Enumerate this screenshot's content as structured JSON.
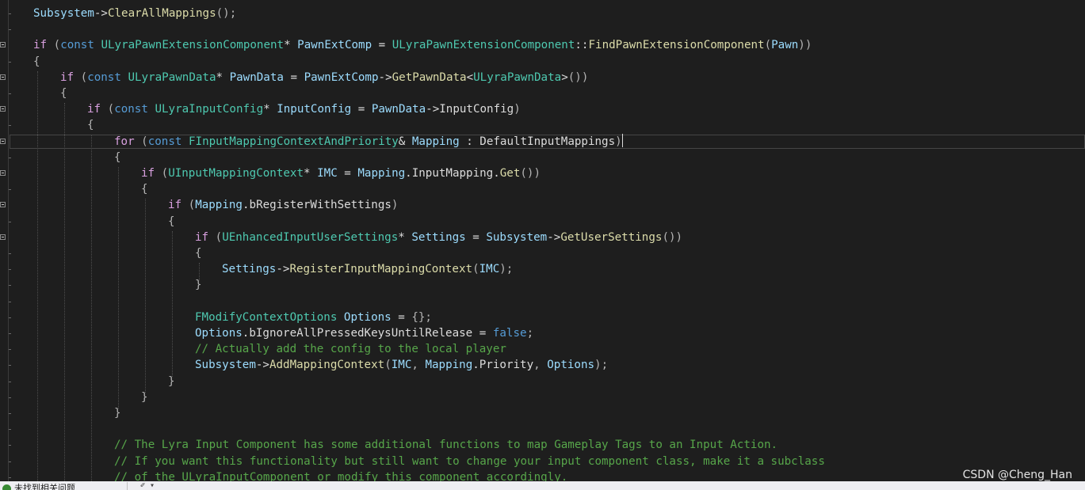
{
  "lines": [
    {
      "indent": 1,
      "tokens": [
        [
          "var",
          "Subsystem"
        ],
        [
          "op",
          "->"
        ],
        [
          "fn",
          "ClearAllMappings"
        ],
        [
          "pn",
          "();"
        ]
      ]
    },
    {
      "indent": 0,
      "tokens": []
    },
    {
      "indent": 1,
      "tokens": [
        [
          "ctl",
          "if"
        ],
        [
          "pn",
          " ("
        ],
        [
          "kw",
          "const"
        ],
        [
          "tx",
          " "
        ],
        [
          "typ",
          "ULyraPawnExtensionComponent"
        ],
        [
          "op",
          "*"
        ],
        [
          "tx",
          " "
        ],
        [
          "var",
          "PawnExtComp"
        ],
        [
          "op",
          " = "
        ],
        [
          "typ",
          "ULyraPawnExtensionComponent"
        ],
        [
          "op",
          "::"
        ],
        [
          "fn",
          "FindPawnExtensionComponent"
        ],
        [
          "pn",
          "("
        ],
        [
          "var",
          "Pawn"
        ],
        [
          "pn",
          "))"
        ]
      ]
    },
    {
      "indent": 1,
      "tokens": [
        [
          "pn",
          "{"
        ]
      ]
    },
    {
      "indent": 2,
      "tokens": [
        [
          "ctl",
          "if"
        ],
        [
          "pn",
          " ("
        ],
        [
          "kw",
          "const"
        ],
        [
          "tx",
          " "
        ],
        [
          "typ",
          "ULyraPawnData"
        ],
        [
          "op",
          "*"
        ],
        [
          "tx",
          " "
        ],
        [
          "var",
          "PawnData"
        ],
        [
          "op",
          " = "
        ],
        [
          "var",
          "PawnExtComp"
        ],
        [
          "op",
          "->"
        ],
        [
          "fn",
          "GetPawnData"
        ],
        [
          "op",
          "<"
        ],
        [
          "typ",
          "ULyraPawnData"
        ],
        [
          "op",
          ">"
        ],
        [
          "pn",
          "())"
        ]
      ]
    },
    {
      "indent": 2,
      "tokens": [
        [
          "pn",
          "{"
        ]
      ]
    },
    {
      "indent": 3,
      "tokens": [
        [
          "ctl",
          "if"
        ],
        [
          "pn",
          " ("
        ],
        [
          "kw",
          "const"
        ],
        [
          "tx",
          " "
        ],
        [
          "typ",
          "ULyraInputConfig"
        ],
        [
          "op",
          "*"
        ],
        [
          "tx",
          " "
        ],
        [
          "var",
          "InputConfig"
        ],
        [
          "op",
          " = "
        ],
        [
          "var",
          "PawnData"
        ],
        [
          "op",
          "->"
        ],
        [
          "tx",
          "InputConfig"
        ],
        [
          "pn",
          ")"
        ]
      ]
    },
    {
      "indent": 3,
      "tokens": [
        [
          "pn",
          "{"
        ]
      ]
    },
    {
      "indent": 4,
      "tokens": [
        [
          "ctl",
          "for"
        ],
        [
          "pn",
          " ("
        ],
        [
          "kw",
          "const"
        ],
        [
          "tx",
          " "
        ],
        [
          "typ",
          "FInputMappingContextAndPriority"
        ],
        [
          "op",
          "&"
        ],
        [
          "tx",
          " "
        ],
        [
          "var",
          "Mapping"
        ],
        [
          "op",
          " : "
        ],
        [
          "tx",
          "DefaultInputMappings"
        ],
        [
          "pn",
          ")"
        ]
      ],
      "current": true
    },
    {
      "indent": 4,
      "tokens": [
        [
          "pn",
          "{"
        ]
      ]
    },
    {
      "indent": 5,
      "tokens": [
        [
          "ctl",
          "if"
        ],
        [
          "pn",
          " ("
        ],
        [
          "typ",
          "UInputMappingContext"
        ],
        [
          "op",
          "*"
        ],
        [
          "tx",
          " "
        ],
        [
          "var",
          "IMC"
        ],
        [
          "op",
          " = "
        ],
        [
          "var",
          "Mapping"
        ],
        [
          "op",
          "."
        ],
        [
          "tx",
          "InputMapping"
        ],
        [
          "op",
          "."
        ],
        [
          "fn",
          "Get"
        ],
        [
          "pn",
          "())"
        ]
      ]
    },
    {
      "indent": 5,
      "tokens": [
        [
          "pn",
          "{"
        ]
      ]
    },
    {
      "indent": 6,
      "tokens": [
        [
          "ctl",
          "if"
        ],
        [
          "pn",
          " ("
        ],
        [
          "var",
          "Mapping"
        ],
        [
          "op",
          "."
        ],
        [
          "tx",
          "bRegisterWithSettings"
        ],
        [
          "pn",
          ")"
        ]
      ]
    },
    {
      "indent": 6,
      "tokens": [
        [
          "pn",
          "{"
        ]
      ]
    },
    {
      "indent": 7,
      "tokens": [
        [
          "ctl",
          "if"
        ],
        [
          "pn",
          " ("
        ],
        [
          "typ",
          "UEnhancedInputUserSettings"
        ],
        [
          "op",
          "*"
        ],
        [
          "tx",
          " "
        ],
        [
          "var",
          "Settings"
        ],
        [
          "op",
          " = "
        ],
        [
          "var",
          "Subsystem"
        ],
        [
          "op",
          "->"
        ],
        [
          "fn",
          "GetUserSettings"
        ],
        [
          "pn",
          "())"
        ]
      ]
    },
    {
      "indent": 7,
      "tokens": [
        [
          "pn",
          "{"
        ]
      ]
    },
    {
      "indent": 8,
      "tokens": [
        [
          "var",
          "Settings"
        ],
        [
          "op",
          "->"
        ],
        [
          "fn",
          "RegisterInputMappingContext"
        ],
        [
          "pn",
          "("
        ],
        [
          "var",
          "IMC"
        ],
        [
          "pn",
          ");"
        ]
      ]
    },
    {
      "indent": 7,
      "tokens": [
        [
          "pn",
          "}"
        ]
      ]
    },
    {
      "indent": 0,
      "tokens": []
    },
    {
      "indent": 7,
      "tokens": [
        [
          "typ",
          "FModifyContextOptions"
        ],
        [
          "tx",
          " "
        ],
        [
          "var",
          "Options"
        ],
        [
          "op",
          " = "
        ],
        [
          "pn",
          "{};"
        ]
      ]
    },
    {
      "indent": 7,
      "tokens": [
        [
          "var",
          "Options"
        ],
        [
          "op",
          "."
        ],
        [
          "tx",
          "bIgnoreAllPressedKeysUntilRelease"
        ],
        [
          "op",
          " = "
        ],
        [
          "kw",
          "false"
        ],
        [
          "pn",
          ";"
        ]
      ]
    },
    {
      "indent": 7,
      "tokens": [
        [
          "cmt",
          "// Actually add the config to the local player"
        ]
      ]
    },
    {
      "indent": 7,
      "tokens": [
        [
          "var",
          "Subsystem"
        ],
        [
          "op",
          "->"
        ],
        [
          "fn",
          "AddMappingContext"
        ],
        [
          "pn",
          "("
        ],
        [
          "var",
          "IMC"
        ],
        [
          "pn",
          ", "
        ],
        [
          "var",
          "Mapping"
        ],
        [
          "op",
          "."
        ],
        [
          "tx",
          "Priority"
        ],
        [
          "pn",
          ", "
        ],
        [
          "var",
          "Options"
        ],
        [
          "pn",
          ");"
        ]
      ]
    },
    {
      "indent": 6,
      "tokens": [
        [
          "pn",
          "}"
        ]
      ]
    },
    {
      "indent": 5,
      "tokens": [
        [
          "pn",
          "}"
        ]
      ]
    },
    {
      "indent": 4,
      "tokens": [
        [
          "pn",
          "}"
        ]
      ]
    },
    {
      "indent": 0,
      "tokens": []
    },
    {
      "indent": 4,
      "tokens": [
        [
          "cmt",
          "// The Lyra Input Component has some additional functions to map Gameplay Tags to an Input Action."
        ]
      ]
    },
    {
      "indent": 4,
      "tokens": [
        [
          "cmt",
          "// If you want this functionality but still want to change your input component class, make it a subclass"
        ]
      ]
    },
    {
      "indent": 4,
      "tokens": [
        [
          "cmt",
          "// of the ULyraInputComponent or modify this component accordingly."
        ]
      ]
    }
  ],
  "watermark": "CSDN @Cheng_Han",
  "status_bar": {
    "issues_text": "未找到相关问题",
    "tools_glyph": "✐ ▾"
  },
  "colors": {
    "background": "#1e1e1e",
    "keyword": "#569cd6",
    "control": "#d8a0df",
    "type": "#4ec9b0",
    "function": "#dcdcaa",
    "variable": "#9cdcfe",
    "comment": "#57a64a",
    "status_ok": "#388a34"
  }
}
